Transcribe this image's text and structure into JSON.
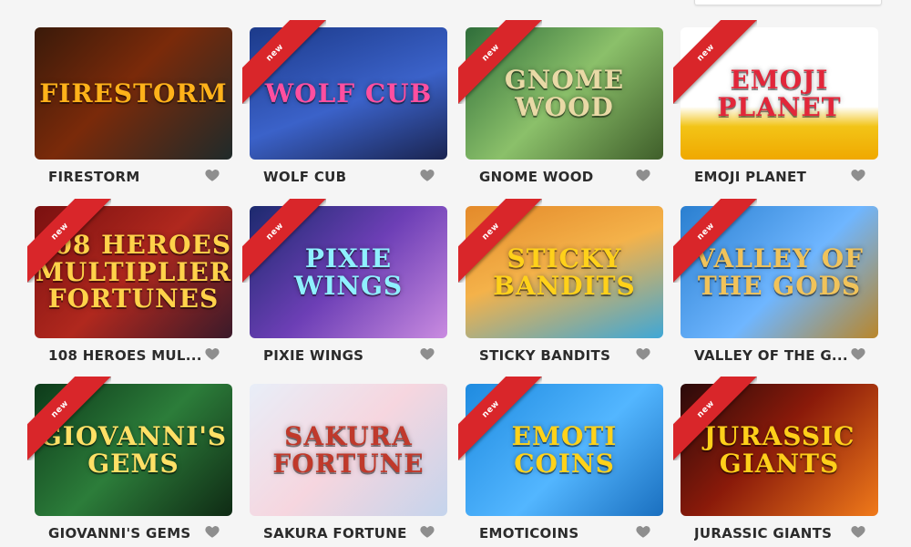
{
  "ribbon_label": "new",
  "favorite_icon": "heart-icon",
  "games": [
    {
      "title": "FIRESTORM",
      "logo": "FIRESTORM",
      "is_new": false,
      "bg": "linear-gradient(135deg,#3a1a0a,#7a2a0a 45%,#1f2a2a)",
      "logo_color": "#ffb21a"
    },
    {
      "title": "WOLF CUB",
      "logo": "Wolf Cub",
      "is_new": true,
      "bg": "linear-gradient(160deg,#1c3a8a,#3b62c9 55%,#1a2450)",
      "logo_color": "#ff4fa0"
    },
    {
      "title": "GNOME WOOD",
      "logo": "Gnome Wood",
      "is_new": true,
      "bg": "linear-gradient(135deg,#2f6e3a,#8bc06a 50%,#3f5e2a)",
      "logo_color": "#e9d9a6"
    },
    {
      "title": "EMOJI PLANET",
      "logo": "emoji planet",
      "is_new": true,
      "bg": "linear-gradient(180deg,#ffffff 0%,#ffffff 60%,#f2c417 75%,#f0a800 100%)",
      "logo_color": "#e2263a"
    },
    {
      "title": "108 HEROES MUL...",
      "logo": "108 HEROES MULTIPLIER FORTUNES",
      "is_new": true,
      "bg": "linear-gradient(135deg,#7a1010,#b0281e 50%,#3a1a2a)",
      "logo_color": "#ffd24a"
    },
    {
      "title": "PIXIE WINGS",
      "logo": "Pixie Wings",
      "is_new": true,
      "bg": "linear-gradient(135deg,#1c2a6e,#6d3fb6 50%,#c98be0)",
      "logo_color": "#8ff0ff"
    },
    {
      "title": "STICKY BANDITS",
      "logo": "STICKY BANDITS",
      "is_new": true,
      "bg": "linear-gradient(160deg,#e48a2a,#f4b24a 45%,#3fa7d6)",
      "logo_color": "#ffd11a"
    },
    {
      "title": "VALLEY OF THE G...",
      "logo": "VALLEY OF THE GODS",
      "is_new": true,
      "bg": "linear-gradient(135deg,#2a7fd0,#6fb6ff 55%,#b9862a)",
      "logo_color": "#f1c35a"
    },
    {
      "title": "GIOVANNI'S GEMS",
      "logo": "Giovanni's Gems",
      "is_new": true,
      "bg": "linear-gradient(135deg,#0d3a1a,#2c7d3a 50%,#0f2a14)",
      "logo_color": "#ffe066"
    },
    {
      "title": "SAKURA FORTUNE",
      "logo": "SAKURA FORTUNE",
      "is_new": false,
      "bg": "linear-gradient(135deg,#e8eef8,#f6d6df 50%,#c4d4ec)",
      "logo_color": "#c0392b"
    },
    {
      "title": "EMOTICOINS",
      "logo": "EMOTI COINS",
      "is_new": true,
      "bg": "linear-gradient(135deg,#1f8be0,#53b6ff 55%,#1a6fbf)",
      "logo_color": "#ffd21a"
    },
    {
      "title": "JURASSIC GIANTS",
      "logo": "JURASSIC GIANTS",
      "is_new": true,
      "bg": "linear-gradient(135deg,#2a0a0a,#8a1a0a 45%,#f07a1a)",
      "logo_color": "#ffcf1a"
    }
  ]
}
